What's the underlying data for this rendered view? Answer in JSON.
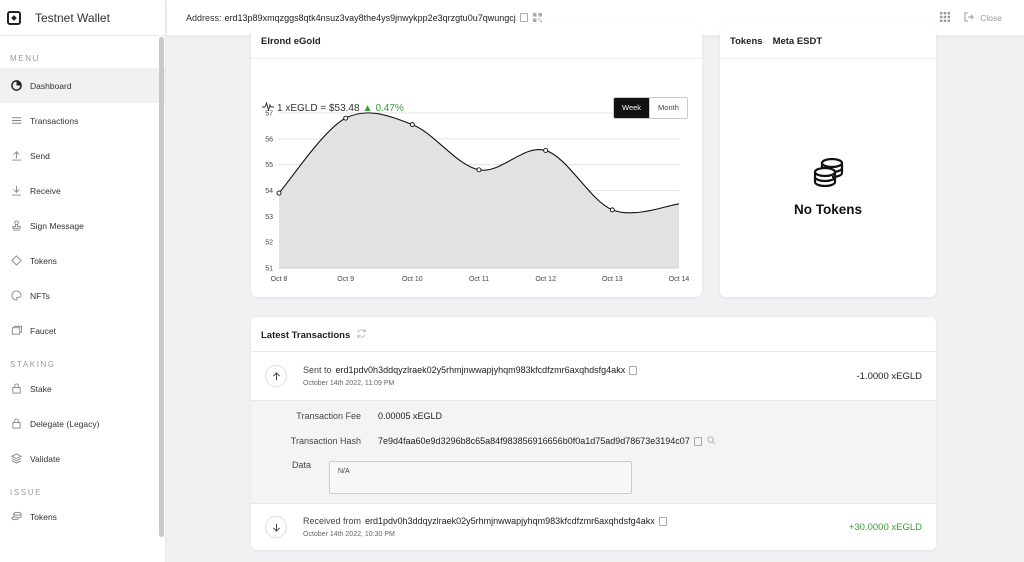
{
  "app": {
    "title": "Testnet Wallet"
  },
  "header": {
    "address_label": "Address:",
    "address": "erd13p89xmqzggs8qtk4nsuz3vay8the4ys9jnwykpp2e3qrzgtu0u7qwungcj",
    "close_label": "Close"
  },
  "sidebar": {
    "section_menu": "MENU",
    "section_staking": "STAKING",
    "section_issue": "ISSUE",
    "menu": [
      {
        "label": "Dashboard",
        "icon": "dashboard-icon",
        "active": true
      },
      {
        "label": "Transactions",
        "icon": "list-icon"
      },
      {
        "label": "Send",
        "icon": "send-icon"
      },
      {
        "label": "Receive",
        "icon": "receive-icon"
      },
      {
        "label": "Sign Message",
        "icon": "stamp-icon"
      },
      {
        "label": "Tokens",
        "icon": "diamond-icon"
      },
      {
        "label": "NFTs",
        "icon": "palette-icon"
      },
      {
        "label": "Faucet",
        "icon": "faucet-icon"
      }
    ],
    "staking": [
      {
        "label": "Stake",
        "icon": "lock-icon"
      },
      {
        "label": "Delegate (Legacy)",
        "icon": "lock-icon"
      },
      {
        "label": "Validate",
        "icon": "layers-icon"
      }
    ],
    "issue": [
      {
        "label": "Tokens",
        "icon": "coins-icon"
      }
    ]
  },
  "egold": {
    "title": "Elrond eGold",
    "price_text": "1 xEGLD = $53.48",
    "change": "0.47%",
    "toggle_week": "Week",
    "toggle_month": "Month"
  },
  "tokens_card": {
    "tab_tokens": "Tokens",
    "tab_meta": "Meta ESDT",
    "empty": "No Tokens"
  },
  "latest": {
    "title": "Latest Transactions",
    "tx1": {
      "direction": "Sent to",
      "address": "erd1pdv0h3ddqyzlraek02y5rhmjnwwapjyhqm983kfcdfzmr6axqhdsfg4akx",
      "date": "October 14th 2022, 11:09 PM",
      "amount": "-1.0000 xEGLD"
    },
    "details": {
      "fee_label": "Transaction Fee",
      "fee": "0.00005 xEGLD",
      "hash_label": "Transaction Hash",
      "hash": "7e9d4faa60e9d3296b8c65a84f983856916656b0f0a1d75ad9d78673e3194c07",
      "data_label": "Data",
      "data": "N/A"
    },
    "tx2": {
      "direction": "Received from",
      "address": "erd1pdv0h3ddqyzlraek02y5rhmjnwwapjyhqm983kfcdfzmr6axqhdsfg4akx",
      "date": "October 14th 2022, 10:30 PM",
      "amount": "+30.0000 xEGLD"
    }
  },
  "chart_data": {
    "type": "area",
    "categories": [
      "Oct 8",
      "Oct 9",
      "Oct 10",
      "Oct 11",
      "Oct 12",
      "Oct 13",
      "Oct 14"
    ],
    "values": [
      53.9,
      56.8,
      56.55,
      54.8,
      55.55,
      53.25,
      53.48
    ],
    "ylim": [
      51,
      57
    ],
    "yticks": [
      51,
      52,
      53,
      54,
      55,
      56,
      57
    ],
    "grid": true,
    "colors": {
      "line": "#111111",
      "fill": "#e2e2e2"
    }
  }
}
